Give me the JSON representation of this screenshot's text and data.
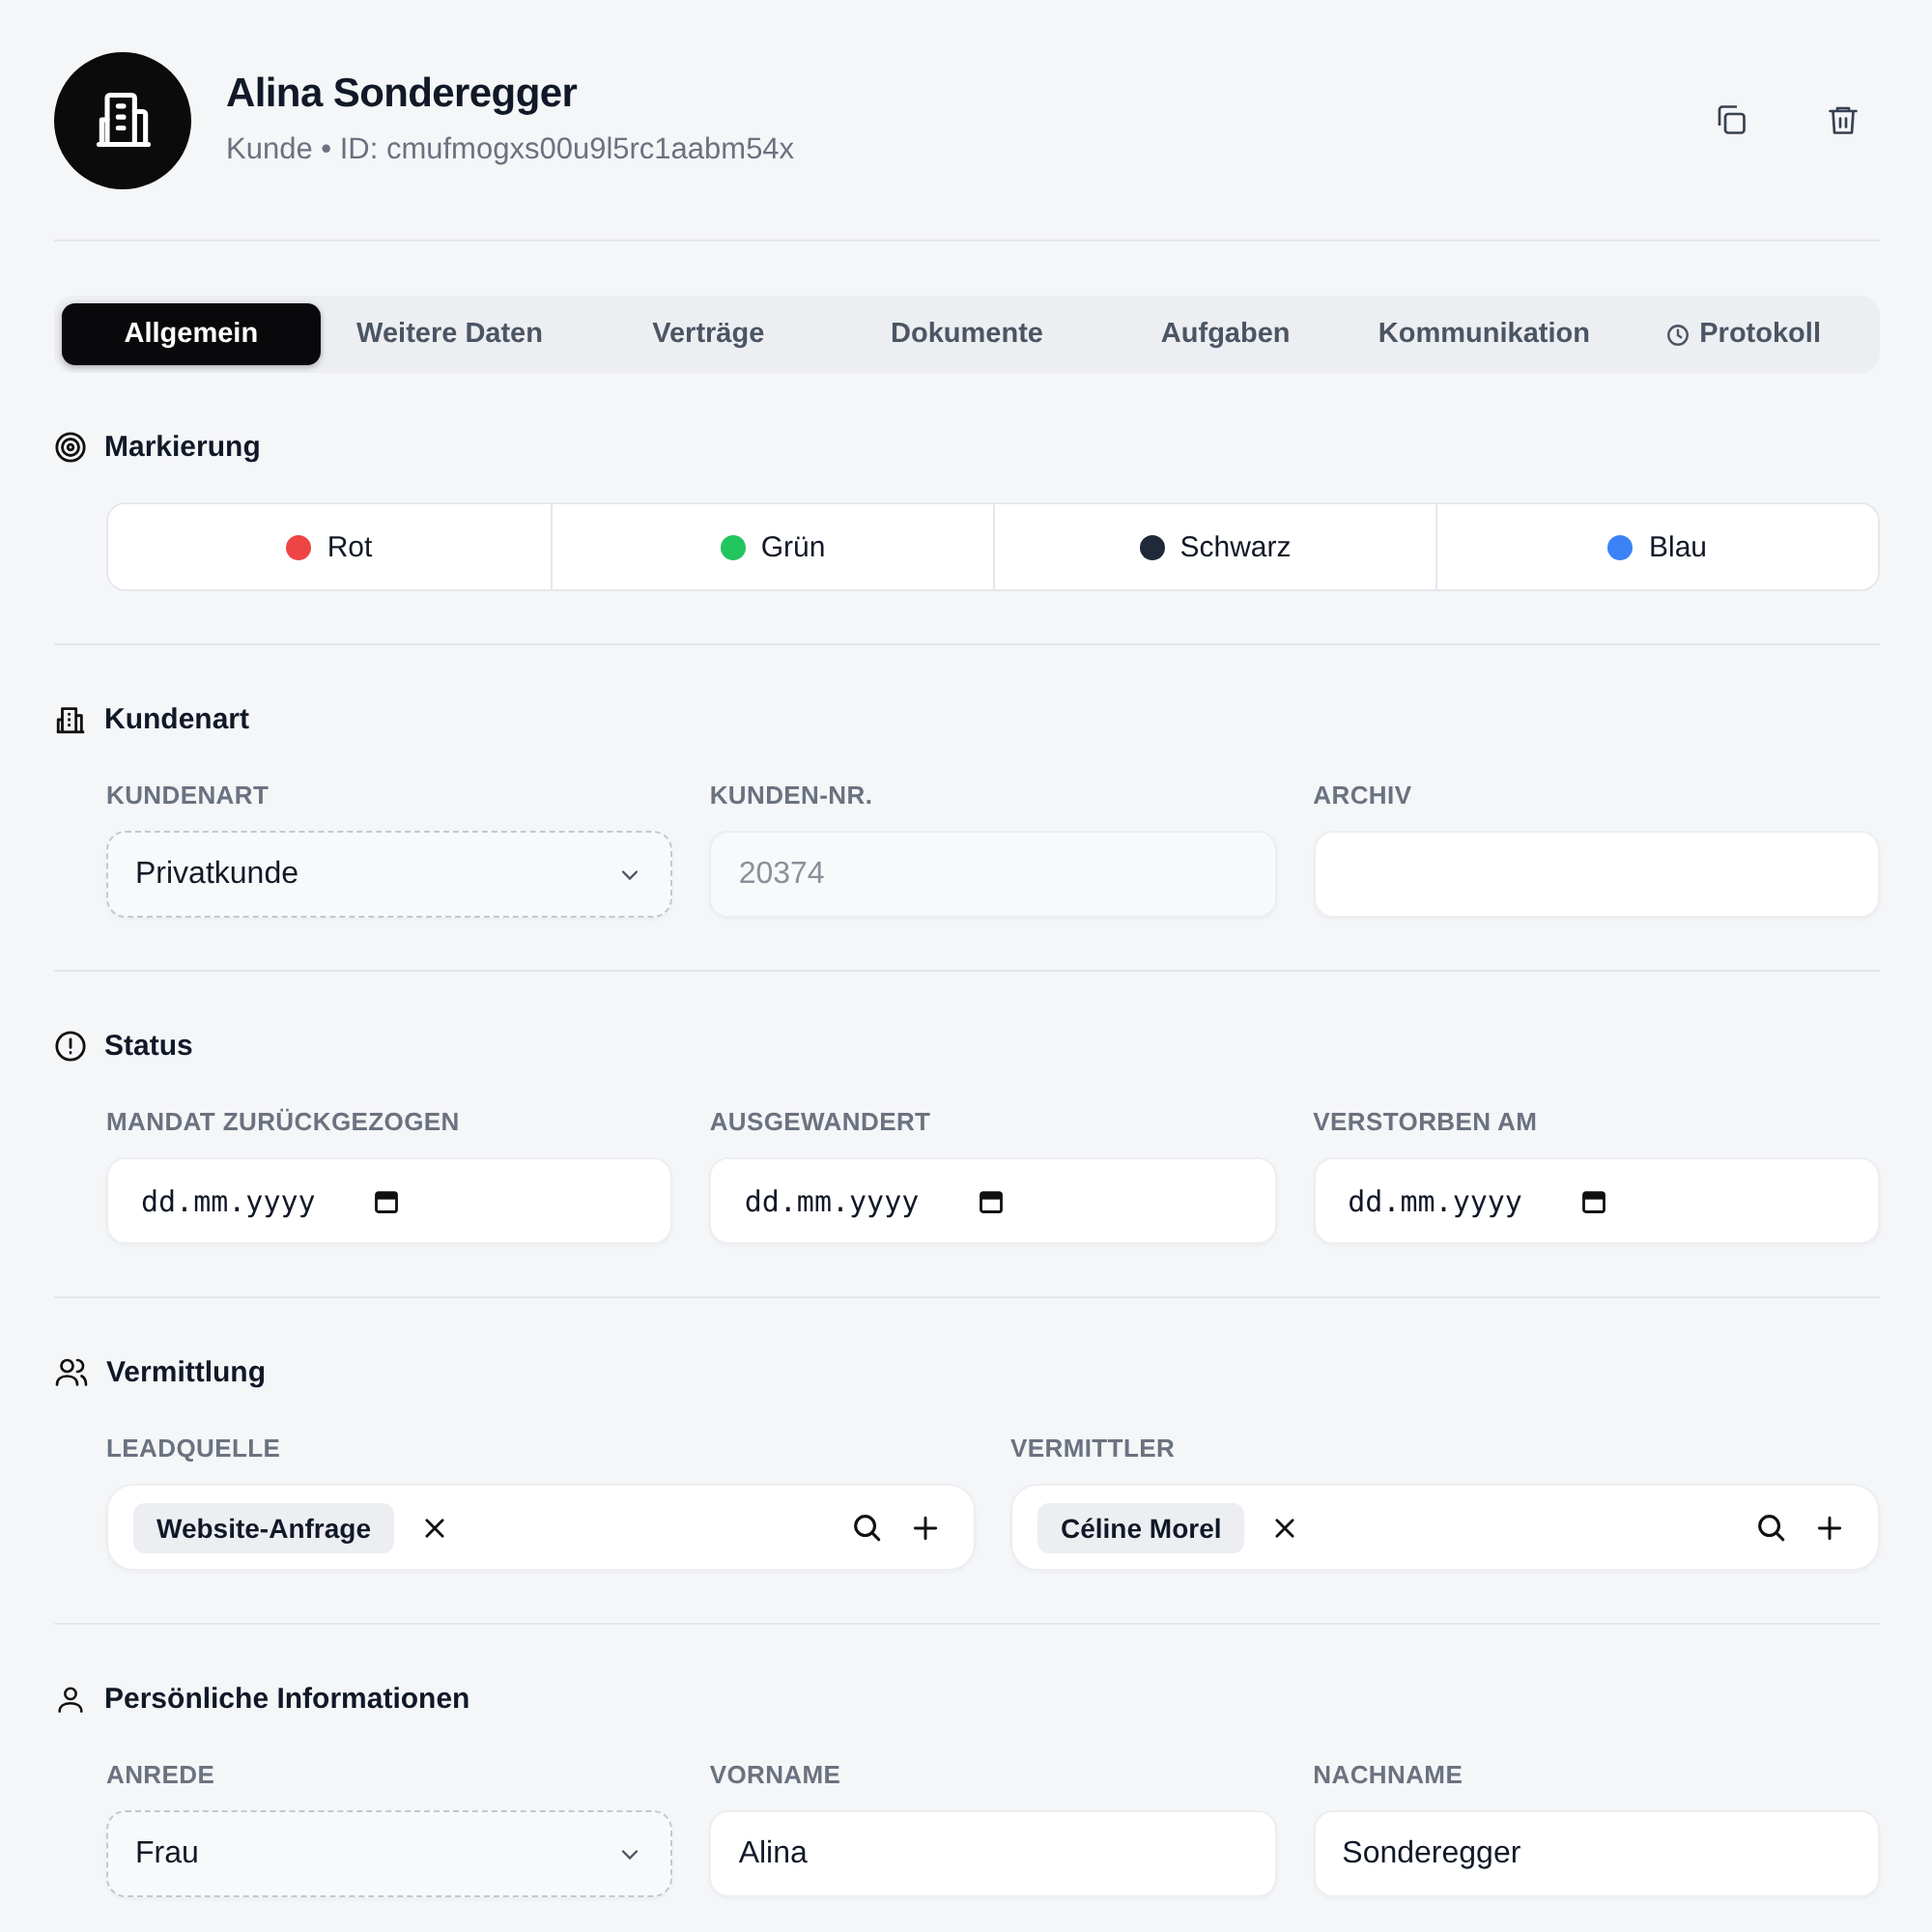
{
  "header": {
    "name": "Alina Sonderegger",
    "subtitle": "Kunde • ID: cmufmogxs00u9l5rc1aabm54x"
  },
  "tabs": [
    {
      "label": "Allgemein",
      "selected": true,
      "kind": "plain"
    },
    {
      "label": "Weitere Daten",
      "selected": false,
      "kind": "plain"
    },
    {
      "label": "Verträge",
      "selected": false,
      "kind": "plain"
    },
    {
      "label": "Dokumente",
      "selected": false,
      "kind": "plain"
    },
    {
      "label": "Aufgaben",
      "selected": false,
      "kind": "plain"
    },
    {
      "label": "Kommunikation",
      "selected": false,
      "kind": "plain"
    },
    {
      "label": "Protokoll",
      "selected": false,
      "kind": "history"
    }
  ],
  "sections": [
    {
      "title": "Markierung",
      "kind": "markers",
      "markers": [
        {
          "label": "Rot",
          "color": "#ef4444"
        },
        {
          "label": "Grün",
          "color": "#22c55e"
        },
        {
          "label": "Schwarz",
          "color": "#1f2937"
        },
        {
          "label": "Blau",
          "color": "#3b82f6"
        }
      ]
    },
    {
      "title": "Kundenart",
      "kind": "fields",
      "fields": [
        {
          "label": "KUNDENART",
          "kind": "select",
          "value": "Privatkunde"
        },
        {
          "label": "KUNDEN-NR.",
          "kind": "readonly",
          "value": "20374"
        },
        {
          "label": "ARCHIV",
          "kind": "text"
        }
      ]
    },
    {
      "title": "Status",
      "kind": "fields",
      "fields": [
        {
          "label": "MANDAT ZURÜCKGEZOGEN",
          "kind": "date",
          "placeholder": "dd.mm.yyyy"
        },
        {
          "label": "AUSGEWANDERT",
          "kind": "date",
          "placeholder": "dd.mm.yyyy"
        },
        {
          "label": "VERSTORBEN AM",
          "kind": "date",
          "placeholder": "dd.mm.yyyy"
        }
      ]
    },
    {
      "title": "Vermittlung",
      "kind": "tags",
      "fields": [
        {
          "label": "LEADQUELLE",
          "kind": "tags",
          "tag": "Website-Anfrage"
        },
        {
          "label": "VERMITTLER",
          "kind": "tags",
          "tag": "Céline Morel"
        }
      ]
    },
    {
      "title": "Persönliche Informationen",
      "kind": "fields",
      "fields": [
        {
          "label": "ANREDE",
          "kind": "select",
          "value": "Frau"
        },
        {
          "label": "VORNAME",
          "kind": "text",
          "value": "Alina"
        },
        {
          "label": "NACHNAME",
          "kind": "text",
          "value": "Sonderegger"
        }
      ]
    }
  ]
}
